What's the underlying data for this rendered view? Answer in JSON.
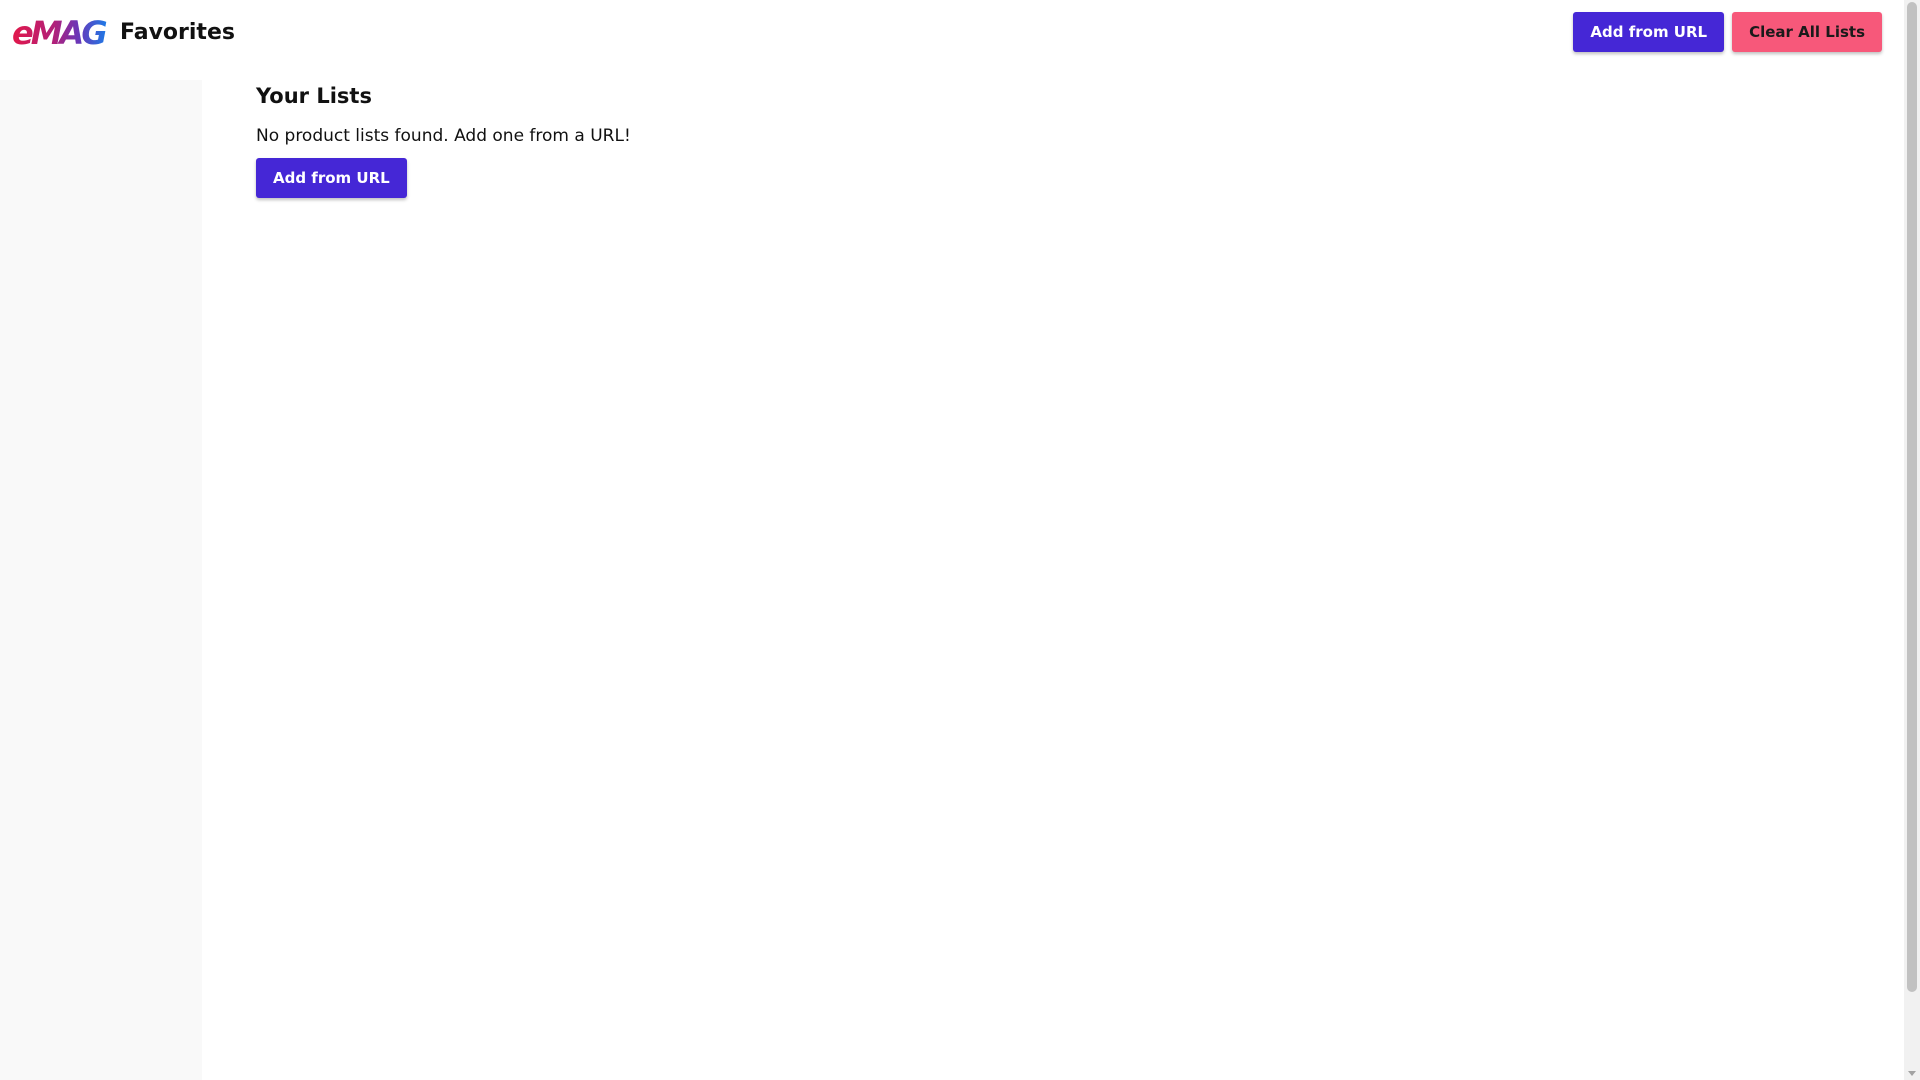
{
  "header": {
    "logo_text": "eMAG",
    "title": "Favorites",
    "add_button_label": "Add from URL",
    "clear_button_label": "Clear All Lists"
  },
  "main": {
    "heading": "Your Lists",
    "empty_message": "No product lists found. Add one from a URL!",
    "add_button_label": "Add from URL"
  },
  "colors": {
    "primary": "#4527d6",
    "danger": "#f7587a",
    "sidebar_bg": "#f9f9f9",
    "logo_red": "#e2184a",
    "logo_purple": "#7a2a9c",
    "logo_blue": "#1e7ae6"
  },
  "icons": {
    "logo": "emag-logo"
  }
}
